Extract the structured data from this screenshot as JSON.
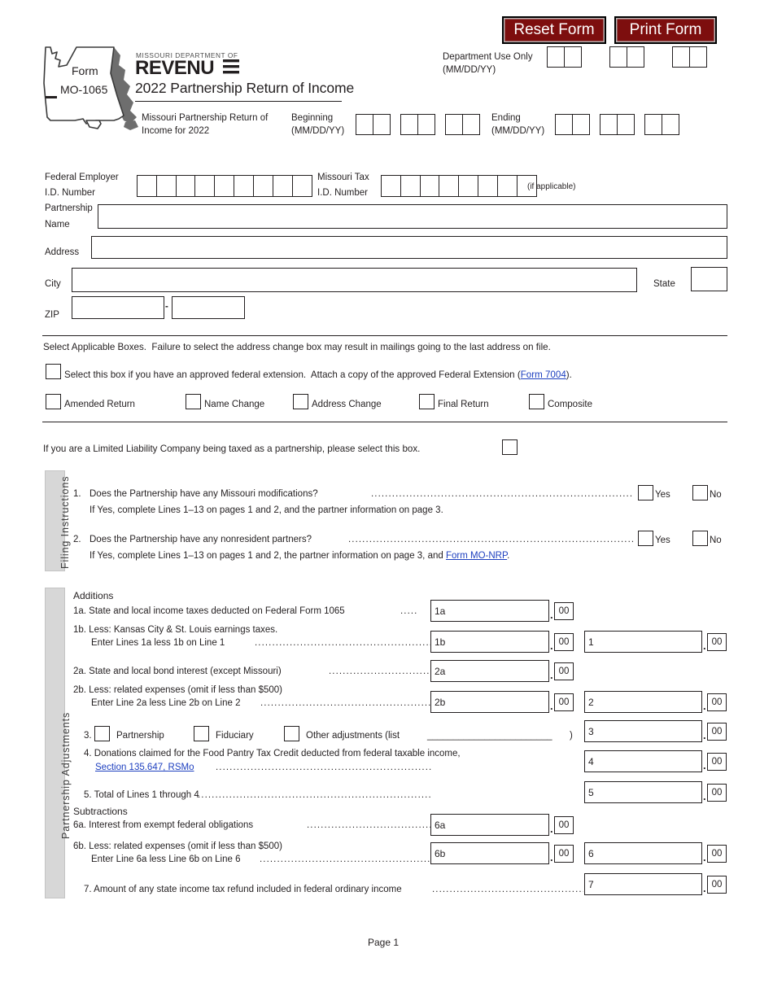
{
  "toolbar": {
    "reset_label": "Reset Form",
    "print_label": "Print Form",
    "button_color": "#7d0e0e"
  },
  "header": {
    "form_word": "Form",
    "form_number": "MO-1065",
    "dept_line": "MISSOURI DEPARTMENT OF",
    "brand": "REVENUE",
    "title": "2022 Partnership Return of Income",
    "subtitle_line1": "Missouri Partnership Return of",
    "subtitle_line2": "Income for 2022",
    "beginning_label_line1": "Beginning",
    "beginning_label_line2": "(MM/DD/YY)",
    "ending_label_line1": "Ending",
    "ending_label_line2": "(MM/DD/YY)",
    "dept_use_line1": "Department Use Only",
    "dept_use_line2": "(MM/DD/YY)"
  },
  "identity": {
    "fein_label_line1": "Federal Employer",
    "fein_label_line2": "I.D. Number",
    "fein_digits": 9,
    "fein_value": "",
    "motax_label_line1": "Missouri Tax",
    "motax_label_line2": "I.D. Number",
    "motax_digits": 8,
    "motax_value": "",
    "motax_note": "(if applicable)",
    "partnership_name_label_line1": "Partnership",
    "partnership_name_label_line2": "Name",
    "partnership_name_value": "",
    "address_label": "Address",
    "address_value": "",
    "city_label": "City",
    "city_value": "",
    "state_label": "State",
    "state_value": "",
    "zip_label": "ZIP",
    "zip_value": "",
    "zip_ext_value": "",
    "zip_separator": "-"
  },
  "applicable": {
    "instruction": "Select Applicable Boxes.  Failure to select the address change box may result in mailings going to the last address on file.",
    "extension_text_before": "Select this box if you have an approved federal extension.  Attach a copy of the approved Federal Extension (",
    "extension_link": "Form 7004",
    "extension_text_after": ").",
    "extension_checked": false,
    "options": [
      {
        "label": "Amended Return",
        "checked": false
      },
      {
        "label": "Name Change",
        "checked": false
      },
      {
        "label": "Address Change",
        "checked": false
      },
      {
        "label": "Final Return",
        "checked": false
      },
      {
        "label": "Composite",
        "checked": false
      }
    ],
    "llc_text": "If you are a Limited Liability Company being taxed as a partnership, please select this box.",
    "llc_checked": false
  },
  "filing_instructions": {
    "tab_label": "Filing Instructions",
    "questions": [
      {
        "number": "1.",
        "text": "Does the Partnership have any Missouri modifications?",
        "sub_before": "If Yes, complete Lines 1–13 on pages 1 and 2, and the partner information on page 3.",
        "sub_link": "",
        "sub_after": "",
        "yes_label": "Yes",
        "no_label": "No",
        "yes_checked": false,
        "no_checked": false
      },
      {
        "number": "2.",
        "text": "Does the Partnership have any nonresident partners?",
        "sub_before": "If Yes, complete Lines 1–13 on pages 1 and 2, the partner information on page 3, and ",
        "sub_link": "Form MO-NRP",
        "sub_after": ".",
        "yes_label": "Yes",
        "no_label": "No",
        "yes_checked": false,
        "no_checked": false
      }
    ]
  },
  "adjustments": {
    "tab_label": "Partnership Adjustments",
    "additions_heading": "Additions",
    "subtractions_heading": "Subtractions",
    "cents_label": "00",
    "lines": [
      {
        "id": "1a",
        "label": "1a. State and local income taxes deducted on Federal Form 1065",
        "mid_tag": "1a",
        "mid_value": "",
        "mid_cents": "00",
        "right_tag": "",
        "right_value": "",
        "right_cents": ""
      },
      {
        "id": "1b",
        "label": "1b. Less: Kansas City & St. Louis earnings taxes.",
        "label2": "Enter Lines 1a less 1b on Line 1",
        "mid_tag": "1b",
        "mid_value": "",
        "mid_cents": "00",
        "right_tag": "1",
        "right_value": "",
        "right_cents": "00"
      },
      {
        "id": "2a",
        "label": "2a. State and local bond interest (except Missouri)",
        "mid_tag": "2a",
        "mid_value": "",
        "mid_cents": "00",
        "right_tag": "",
        "right_value": "",
        "right_cents": ""
      },
      {
        "id": "2b",
        "label": "2b. Less: related expenses (omit if less than $500)",
        "label2": "Enter Line 2a less Line 2b on Line 2",
        "mid_tag": "2b",
        "mid_value": "",
        "mid_cents": "00",
        "right_tag": "2",
        "right_value": "",
        "right_cents": "00"
      }
    ],
    "line3": {
      "number": "3.",
      "options": [
        {
          "label": "Partnership",
          "checked": false
        },
        {
          "label": "Fiduciary",
          "checked": false
        },
        {
          "label": "Other adjustments (list",
          "checked": false
        }
      ],
      "list_blank": "________________________",
      "close_paren": ")",
      "right_tag": "3",
      "right_value": "",
      "right_cents": "00"
    },
    "line4": {
      "text_line1": "4. Donations claimed for the Food Pantry Tax Credit deducted from federal taxable income,",
      "link": "Section 135.647, RSMo",
      "right_tag": "4",
      "right_value": "",
      "right_cents": "00"
    },
    "line5": {
      "text": "5. Total of Lines 1 through 4",
      "right_tag": "5",
      "right_value": "",
      "right_cents": "00"
    },
    "line6a": {
      "label": "6a. Interest from exempt federal obligations",
      "mid_tag": "6a",
      "mid_value": "",
      "mid_cents": "00"
    },
    "line6b": {
      "label": "6b. Less: related expenses (omit if less than $500)",
      "label2": "Enter Line 6a less Line 6b on Line 6",
      "mid_tag": "6b",
      "mid_value": "",
      "mid_cents": "00",
      "right_tag": "6",
      "right_value": "",
      "right_cents": "00"
    },
    "line7": {
      "text": "7. Amount of any state income tax refund included in federal ordinary income",
      "right_tag": "7",
      "right_value": "",
      "right_cents": "00"
    }
  },
  "footer": {
    "page_label": "Page 1"
  }
}
